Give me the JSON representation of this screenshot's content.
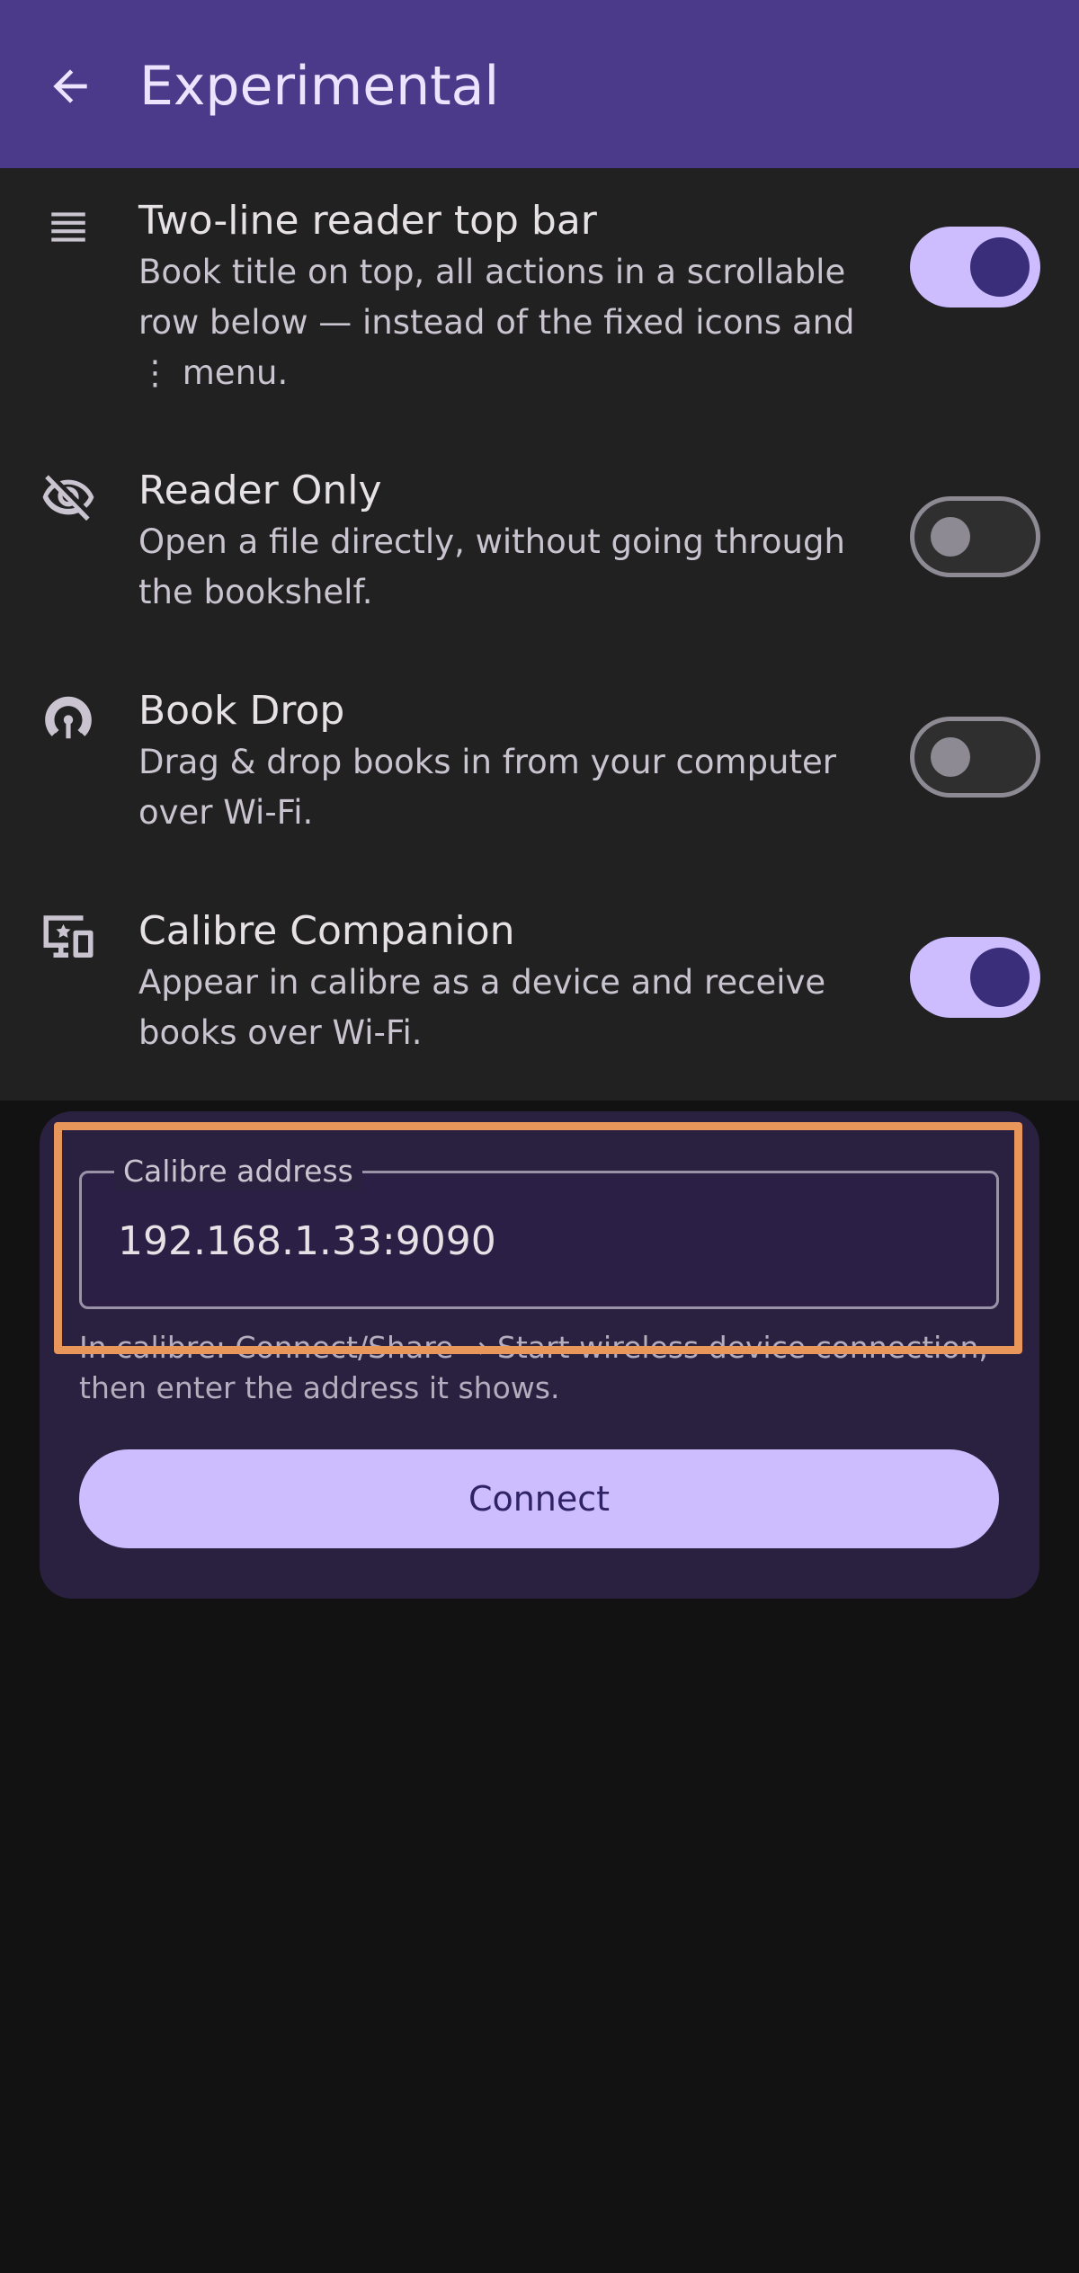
{
  "appbar": {
    "title": "Experimental",
    "back_icon": "arrow-back-icon"
  },
  "settings": [
    {
      "icon": "reader-top-bar-icon",
      "title": "Two-line reader top bar",
      "description": "Book title on top, all actions in a scrollable row below — instead of the fixed icons and ⋮ menu.",
      "enabled": true
    },
    {
      "icon": "eye-off-icon",
      "title": "Reader Only",
      "description": "Open a file directly, without going through the bookshelf.",
      "enabled": false
    },
    {
      "icon": "wifi-tethering-icon",
      "title": "Book Drop",
      "description": "Drag & drop books in from your computer over Wi-Fi.",
      "enabled": false
    },
    {
      "icon": "devices-icon",
      "title": "Calibre Companion",
      "description": "Appear in calibre as a device and receive books over Wi-Fi.",
      "enabled": true
    }
  ],
  "calibre": {
    "field_label": "Calibre address",
    "field_value": "192.168.1.33:9090",
    "helper": "In calibre: Connect/Share → Start wireless device connection, then enter the address it shows.",
    "connect_label": "Connect"
  },
  "colors": {
    "appbar": "#4b3a8a",
    "accent": "#cdbdff",
    "highlight": "#e8965a"
  }
}
